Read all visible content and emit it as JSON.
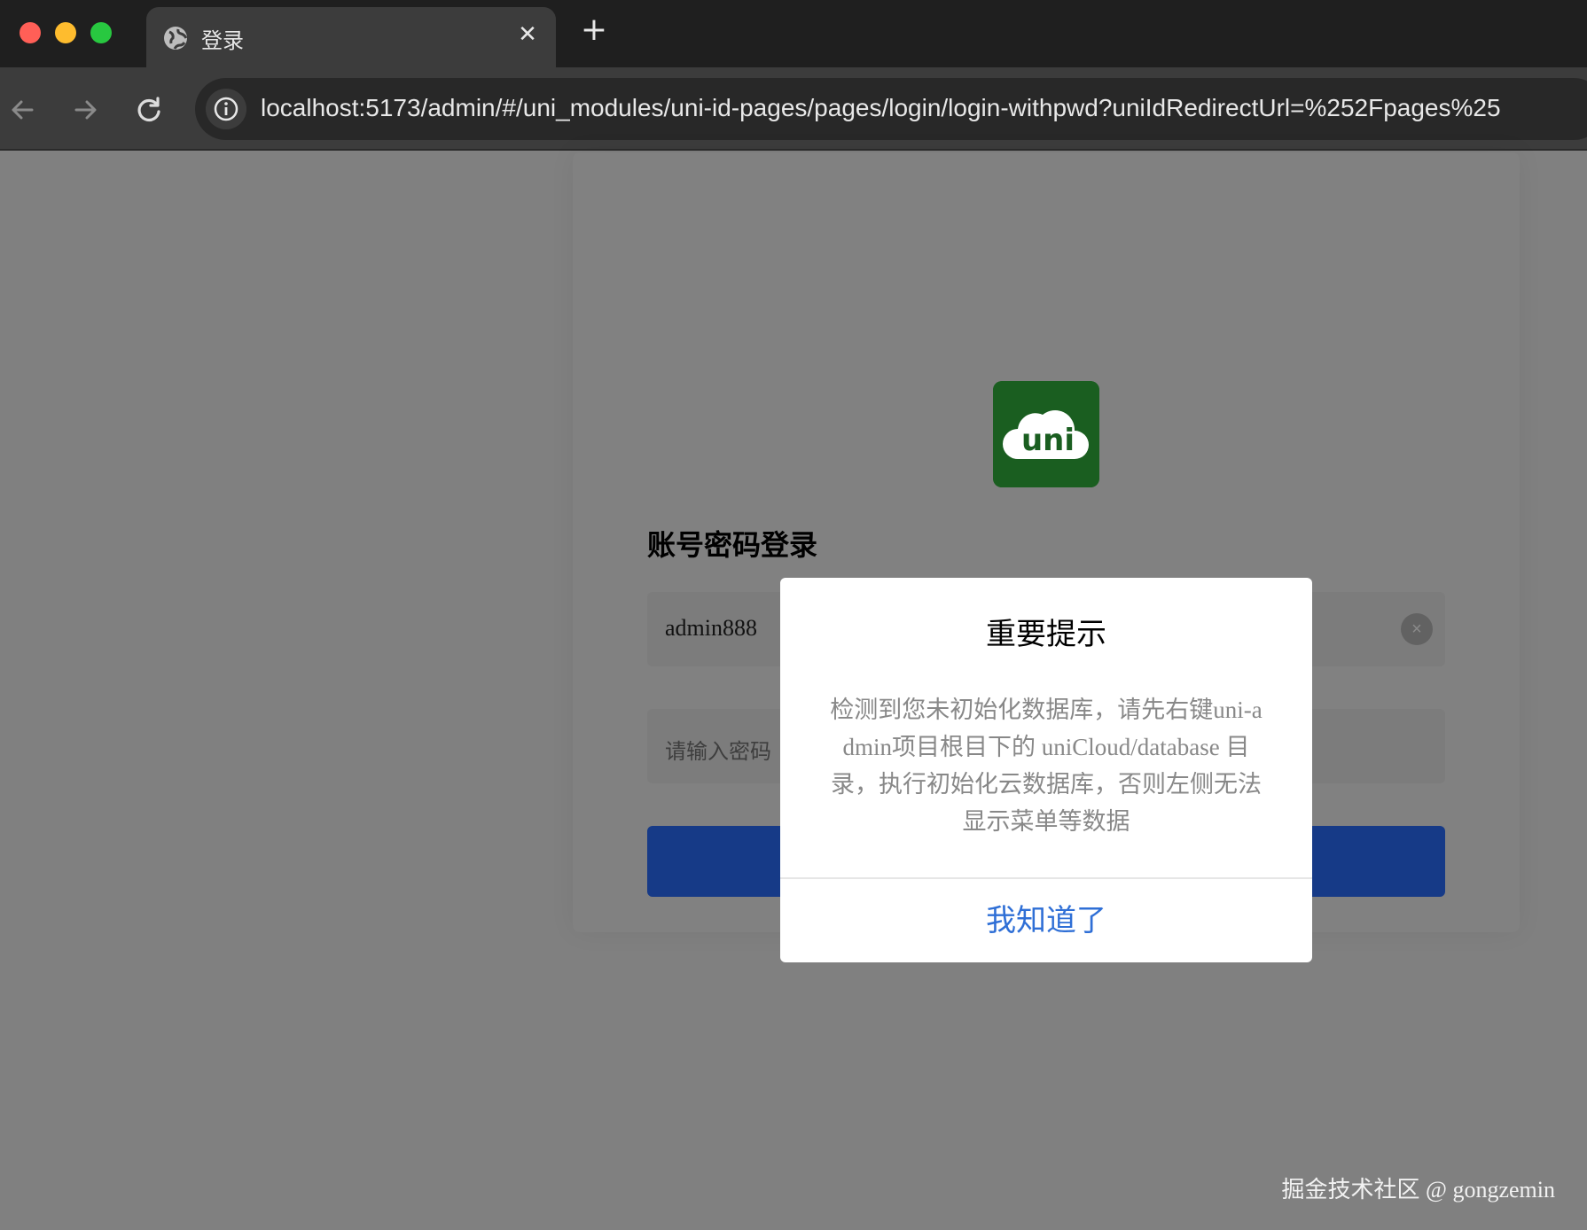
{
  "browser": {
    "tab_title": "登录",
    "tab_close_glyph": "✕",
    "new_tab_glyph": "+",
    "url": "localhost:5173/admin/#/uni_modules/uni-id-pages/pages/login/login-withpwd?uniIdRedirectUrl=%252Fpages%25"
  },
  "login": {
    "logo_text": "uni",
    "title": "账号密码登录",
    "username_value": "admin888",
    "password_placeholder": "请输入密码",
    "clear_glyph": "×"
  },
  "modal": {
    "title": "重要提示",
    "message": "检测到您未初始化数据库，请先右键uni-admin项目根目下的 uniCloud/database 目录，执行初始化云数据库，否则左侧无法显示菜单等数据",
    "confirm_label": "我知道了"
  },
  "watermark": "掘金技术社区 @ gongzemin",
  "colors": {
    "overlay_page": "#808080",
    "logo_bg": "#1a5e20",
    "login_button": "#163a87",
    "modal_confirm": "#2f6fd6"
  }
}
